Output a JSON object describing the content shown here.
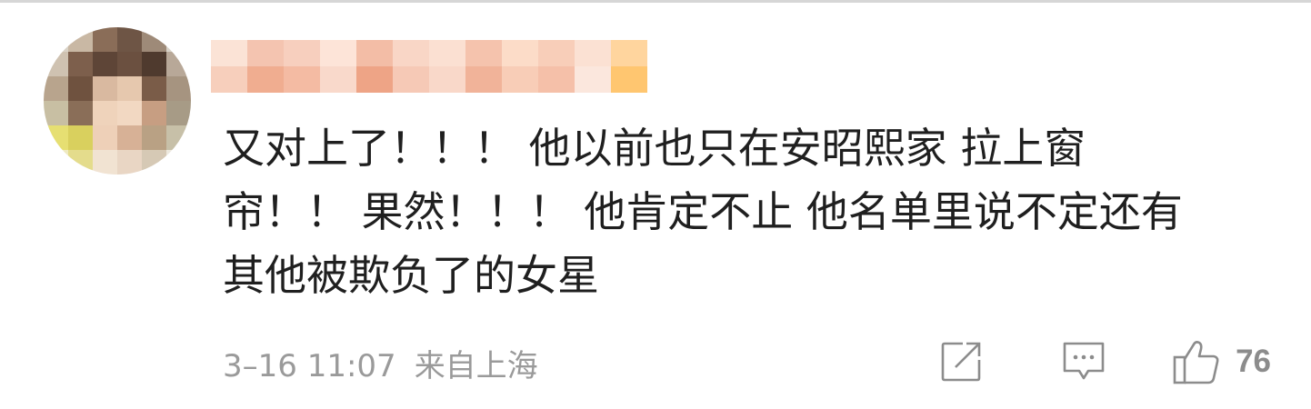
{
  "comment": {
    "avatar_icon": "avatar-pixelated-icon",
    "username_icon": "username-pixelated-icon",
    "text_lines": [
      "又对上了！！！ 他以前也只在安昭熙家 拉上窗",
      "帘！！ 果然！！！ 他肯定不止 他名单里说不定还有",
      "其他被欺负了的女星"
    ],
    "timestamp": "3–16 11:07",
    "location": "来自上海",
    "actions": {
      "share_icon": "share-icon",
      "comment_icon": "comment-icon",
      "like_icon": "thumbs-up-icon",
      "like_count": "76"
    }
  },
  "colors": {
    "text": "#1f1f1f",
    "meta": "#9a9a9a",
    "icon": "#8c8c8c"
  }
}
